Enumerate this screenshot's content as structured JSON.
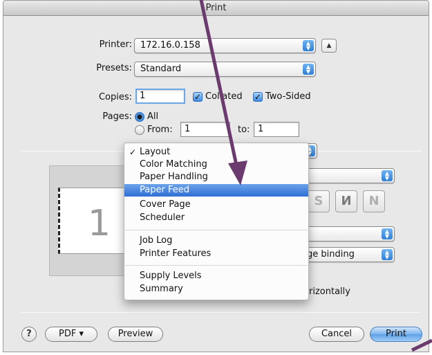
{
  "window": {
    "title": "Print"
  },
  "printer": {
    "label": "Printer:",
    "value": "172.16.0.158"
  },
  "presets": {
    "label": "Presets:",
    "value": "Standard"
  },
  "copies": {
    "label": "Copies:",
    "value": "1",
    "collated_label": "Collated",
    "collated_checked": true,
    "two_sided_label": "Two-Sided",
    "two_sided_checked": true
  },
  "pages": {
    "label": "Pages:",
    "all_label": "All",
    "all_selected": true,
    "from_label": "From:",
    "from_value": "1",
    "to_label": "to:",
    "to_value": "1"
  },
  "preview": {
    "page_number": "1"
  },
  "layout_panel": {
    "binding_value": "ge binding",
    "flip_text": "rizontally"
  },
  "menu": {
    "items": [
      {
        "label": "Layout",
        "checked": true
      },
      {
        "label": "Color Matching"
      },
      {
        "label": "Paper Handling"
      },
      {
        "label": "Paper Feed",
        "highlighted": true
      },
      {
        "label": "Cover Page"
      },
      {
        "label": "Scheduler"
      },
      {
        "label": "Job Log"
      },
      {
        "label": "Printer Features"
      },
      {
        "label": "Supply Levels"
      },
      {
        "label": "Summary"
      }
    ],
    "check_glyph": "✓"
  },
  "buttons": {
    "help": "?",
    "pdf": "PDF ▾",
    "preview": "Preview",
    "cancel": "Cancel",
    "print": "Print"
  },
  "annotation": {
    "arrow_color": "#6b3a6e"
  },
  "icons": {
    "stepper": "up-down-arrows-icon",
    "disclosure": "up-triangle-icon"
  }
}
